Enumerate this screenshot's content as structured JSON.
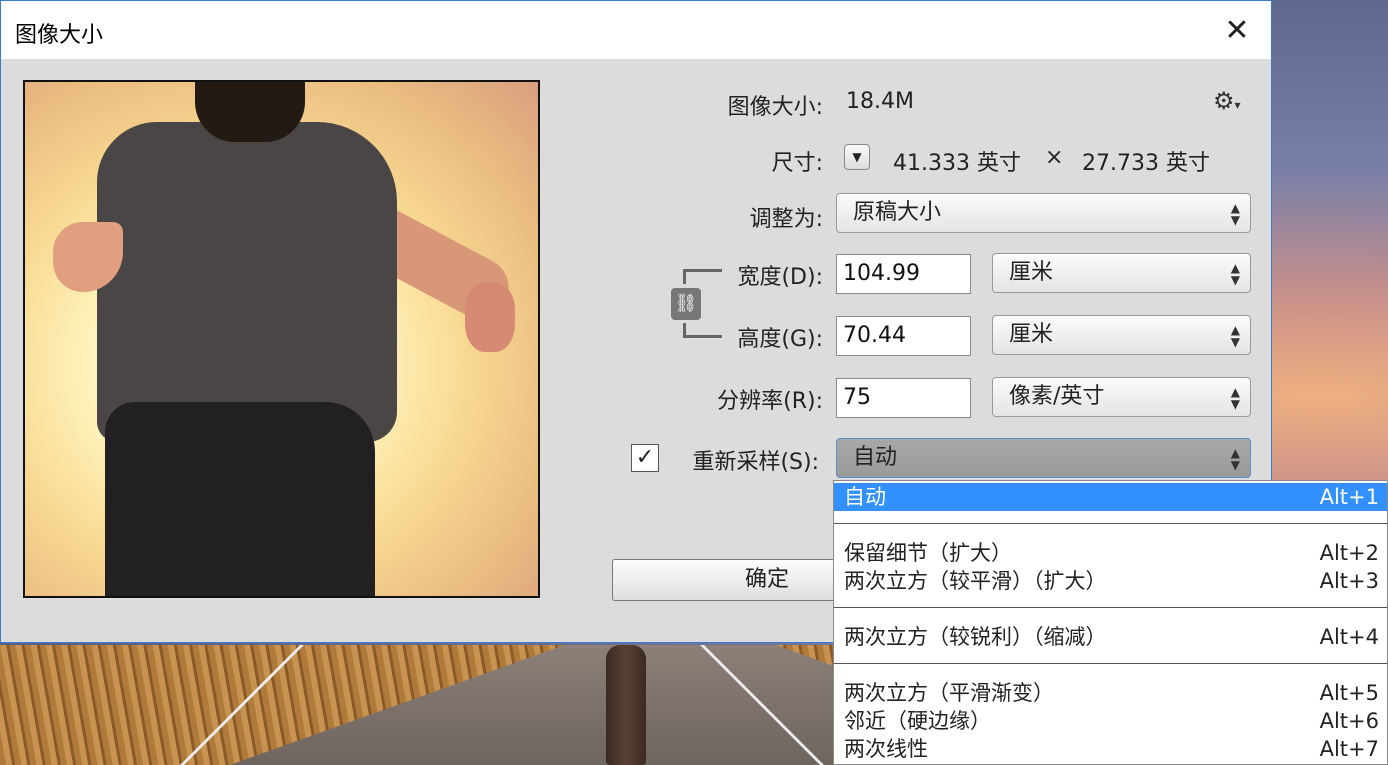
{
  "dialog": {
    "title": "图像大小",
    "close_glyph": "✕"
  },
  "info": {
    "size_label": "图像大小:",
    "size_value": "18.4M",
    "dims_label": "尺寸:",
    "dims_width": "41.333 英寸",
    "dims_times": "×",
    "dims_height": "27.733 英寸"
  },
  "fit": {
    "label": "调整为:",
    "value": "原稿大小"
  },
  "width": {
    "label": "宽度(D):",
    "value": "104.99",
    "unit": "厘米"
  },
  "height": {
    "label": "高度(G):",
    "value": "70.44",
    "unit": "厘米"
  },
  "resolution": {
    "label": "分辨率(R):",
    "value": "75",
    "unit": "像素/英寸"
  },
  "resample": {
    "checked": true,
    "check_glyph": "✓",
    "label": "重新采样(S):",
    "value": "自动"
  },
  "buttons": {
    "ok": "确定"
  },
  "menu": {
    "items": [
      {
        "label": "自动",
        "shortcut": "Alt+1",
        "selected": true
      },
      {
        "label": "保留细节（扩大）",
        "shortcut": "Alt+2"
      },
      {
        "label": "两次立方（较平滑）（扩大）",
        "shortcut": "Alt+3"
      },
      {
        "label": "两次立方（较锐利）（缩减）",
        "shortcut": "Alt+4"
      },
      {
        "label": "两次立方（平滑渐变）",
        "shortcut": "Alt+5"
      },
      {
        "label": "邻近（硬边缘）",
        "shortcut": "Alt+6"
      },
      {
        "label": "两次线性",
        "shortcut": "Alt+7"
      }
    ]
  },
  "icons": {
    "gear": "gear-icon",
    "link": "link-icon",
    "dropdown": "chevron-down-icon",
    "updown": "updown-arrows-icon"
  },
  "colors": {
    "menu_highlight": "#3391ff",
    "dialog_border": "#3d7cc9"
  }
}
